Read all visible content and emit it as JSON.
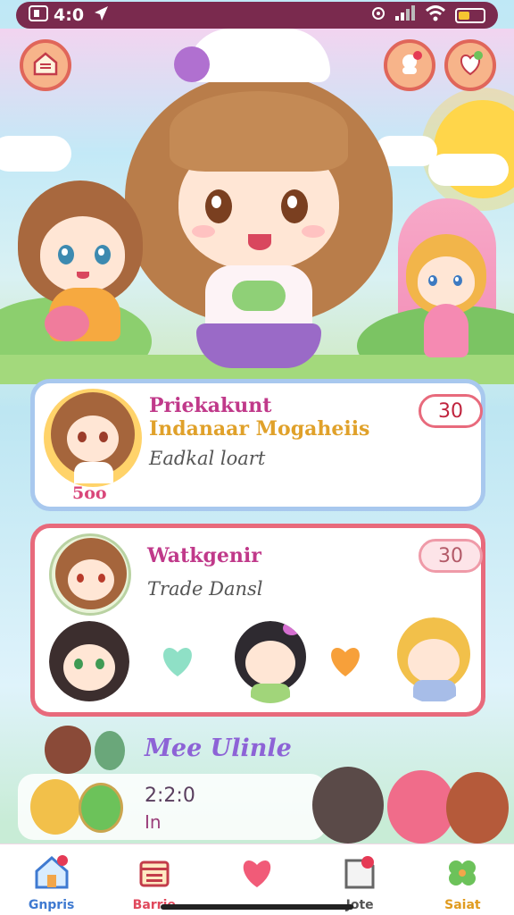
{
  "status": {
    "time": "4:0",
    "icons": [
      "message-icon",
      "location-arrow-icon",
      "cast-icon",
      "signal-icon",
      "wifi-icon",
      "battery-icon"
    ],
    "battery_color": "#f5c531"
  },
  "top_buttons": {
    "left_icon": "home-icon",
    "right_icons": [
      "profile-notify-icon",
      "heart-check-icon"
    ]
  },
  "card_1": {
    "title": "Priekakunt",
    "subtitle": "Indanaar Mogaheiis",
    "description": "Eadkal loart",
    "avatar_caption": "5oo",
    "badge": "30",
    "colors": {
      "title": "#c0398a",
      "subtitle": "#e0a12a",
      "border": "#a8c8ee",
      "badge": "#e86a7c"
    }
  },
  "card_2": {
    "title": "Watkgenir",
    "description": "Trade Dansl",
    "badge": "30",
    "hearts": [
      "#8fe0c6",
      "#f7a03a"
    ],
    "colors": {
      "title": "#c0398a",
      "border": "#e86a7c",
      "badge_border": "#ef9aa8"
    }
  },
  "lower": {
    "title": "Mee Ulinle",
    "time": "2:2:0",
    "sub": "In"
  },
  "nav": [
    {
      "label": "Gnpris",
      "icon": "house-notify-icon",
      "color": "#3f7ad1"
    },
    {
      "label": "Barrie",
      "icon": "gift-box-icon",
      "color": "#e0485c"
    },
    {
      "label": "",
      "icon": "heart-icon",
      "color": "#f15b78"
    },
    {
      "label": "Jote",
      "icon": "page-notify-icon",
      "color": "#555555"
    },
    {
      "label": "Saiat",
      "icon": "clover-icon",
      "color": "#e09b1e"
    }
  ]
}
